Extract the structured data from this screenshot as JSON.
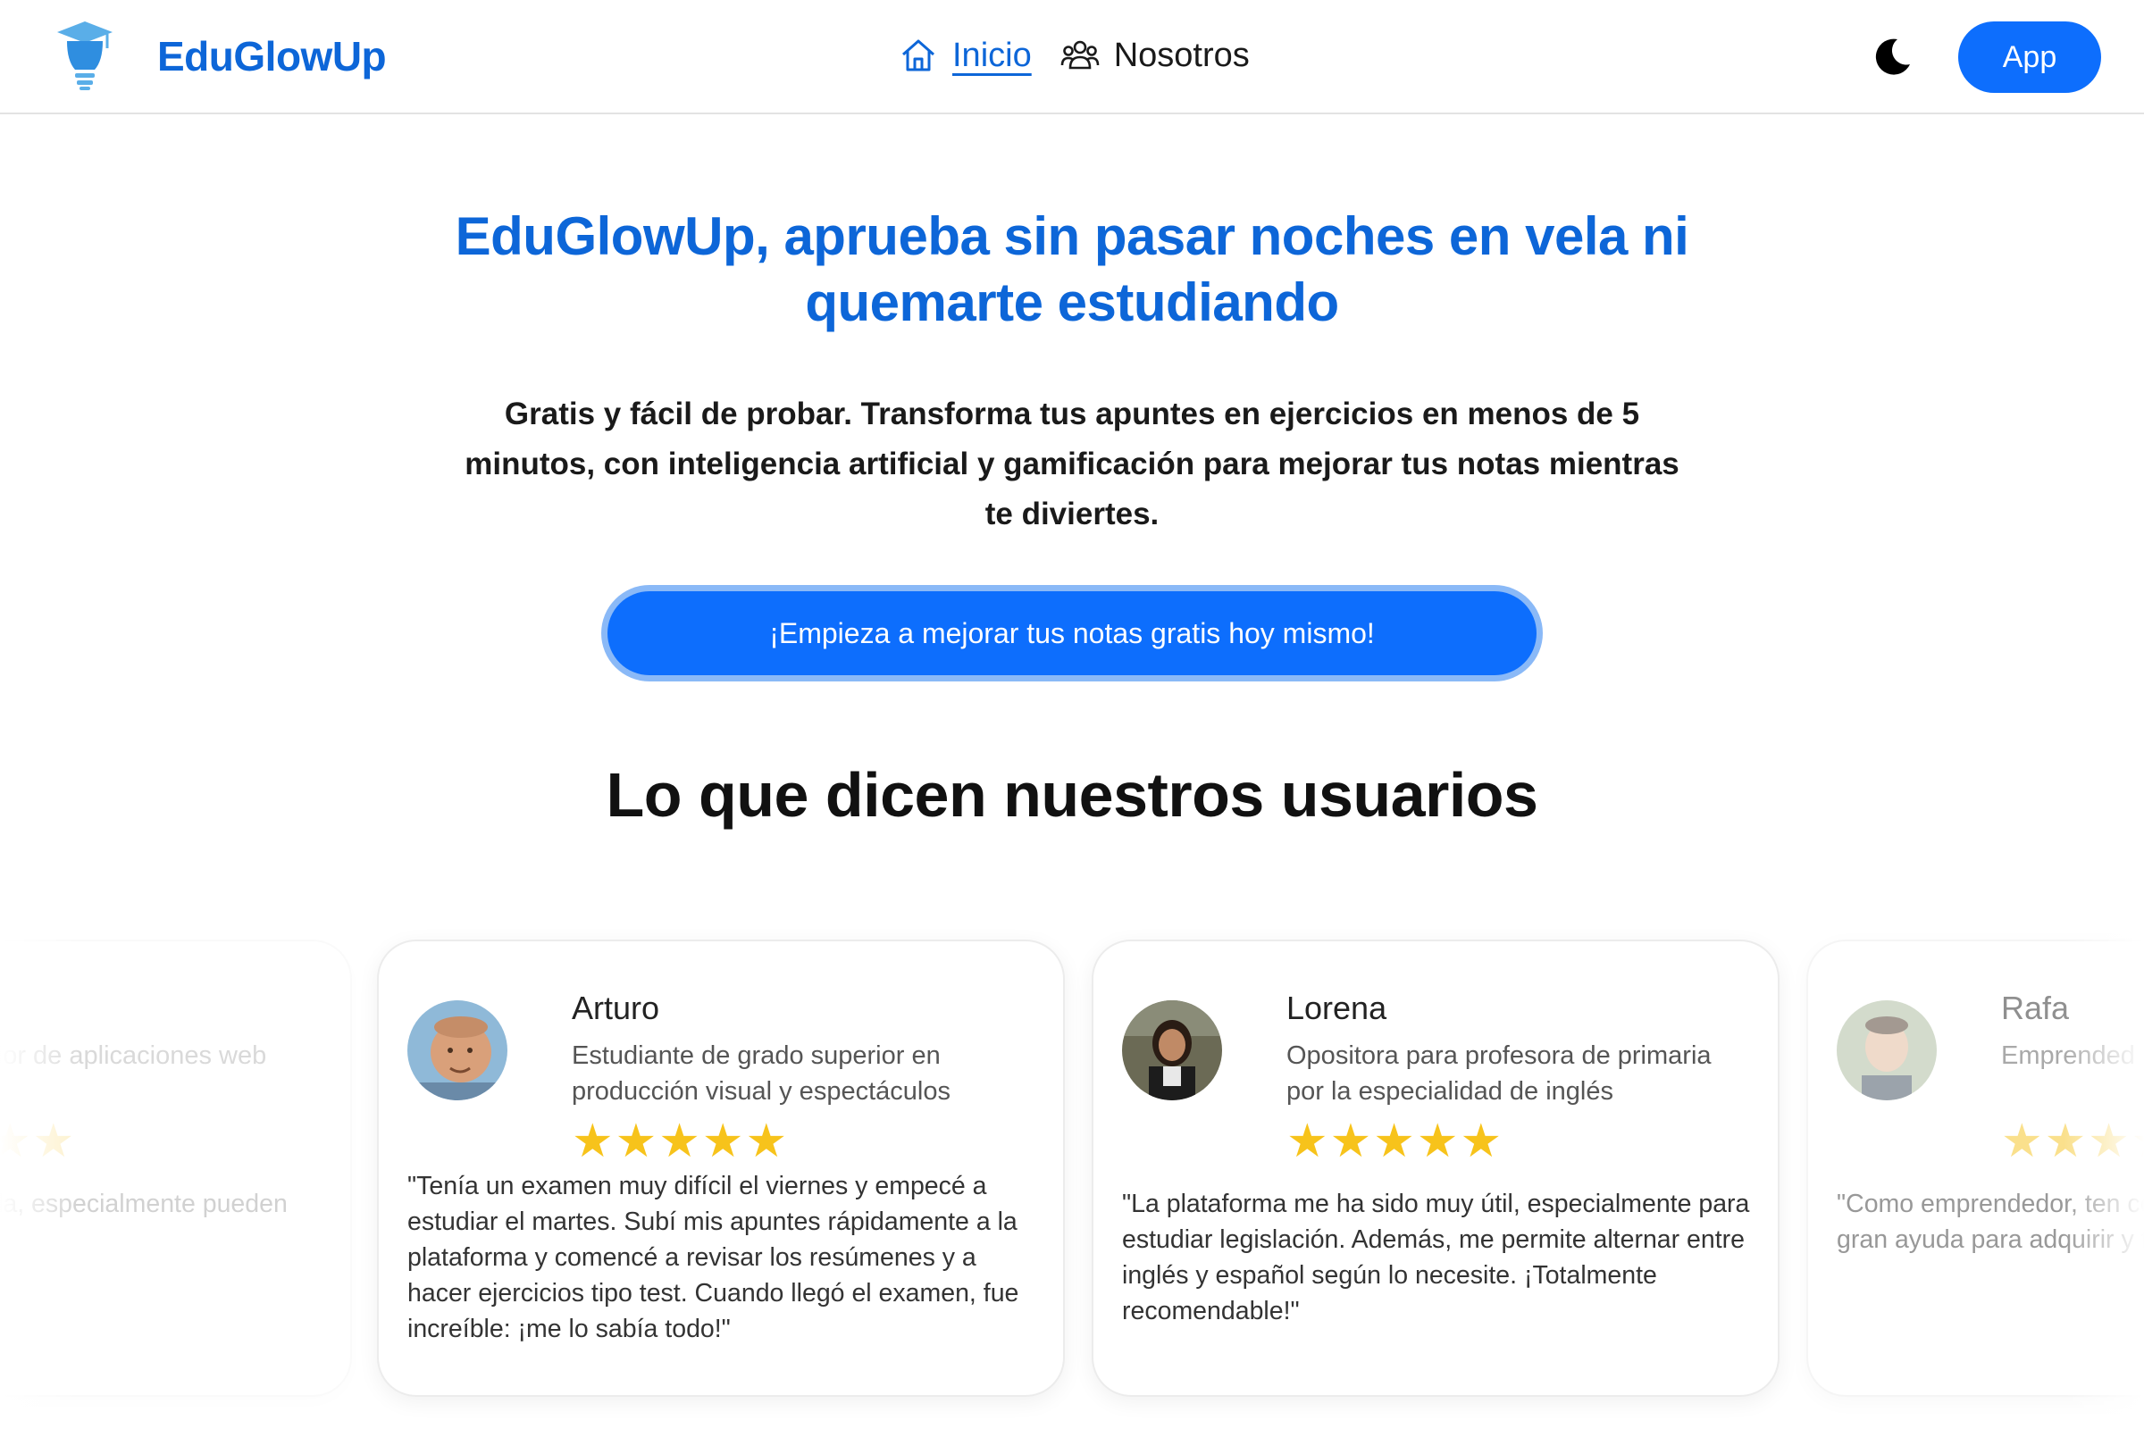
{
  "header": {
    "brand": "EduGlowUp",
    "nav": [
      {
        "label": "Inicio",
        "icon": "home-icon",
        "active": true
      },
      {
        "label": "Nosotros",
        "icon": "users-icon",
        "active": false
      }
    ],
    "theme_toggle_icon": "moon-icon",
    "app_button": "App"
  },
  "hero": {
    "title_line1": "EduGlowUp, aprueba sin pasar noches en vela ni",
    "title_line2": "quemarte estudiando",
    "subtitle": "Gratis y fácil de probar. Transforma tus apuntes en ejercicios en menos de 5 minutos, con inteligencia artificial y gamificación para mejorar tus notas mientras te diviertes.",
    "cta": "¡Empieza a mejorar tus notas gratis hoy mismo!"
  },
  "testimonials": {
    "title": "Lo que dicen nuestros usuarios",
    "items": [
      {
        "name": "",
        "role": "grado superior de aplicaciones web",
        "rating": 5,
        "quote": "a repasar conceptos sencilla, especialmente pueden ser más aburridas"
      },
      {
        "name": "Arturo",
        "role": "Estudiante de grado superior en producción visual y espectáculos",
        "rating": 5,
        "quote": "\"Tenía un examen muy difícil el viernes y empecé a estudiar el martes. Subí mis apuntes rápidamente a la plataforma y comencé a revisar los resúmenes y a hacer ejercicios tipo test. Cuando llegó el examen, fue increíble: ¡me lo sabía todo!\""
      },
      {
        "name": "Lorena",
        "role": "Opositora para profesora de primaria por la especialidad de inglés",
        "rating": 5,
        "quote": "\"La plataforma me ha sido muy útil, especialmente para estudiar legislación. Además, me permite alternar entre inglés y español según lo necesite. ¡Totalmente recomendable!\""
      },
      {
        "name": "Rafa",
        "role": "Emprended",
        "rating": 5,
        "quote": "\"Como emprendedor, ten cosas en poco tiempo. Ed gran ayuda para adquirir y finanzas.\""
      }
    ]
  },
  "colors": {
    "brand": "#0d66d8",
    "button": "#0d6efd",
    "star": "#f7c31b"
  }
}
